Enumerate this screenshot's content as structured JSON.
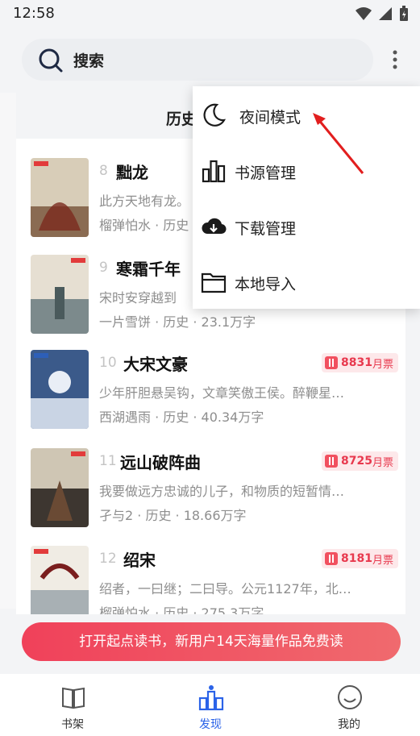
{
  "status": {
    "time": "12:58"
  },
  "search": {
    "label": "搜索"
  },
  "tabs": {
    "history": "历史"
  },
  "books": [
    {
      "rank": "8",
      "title": "黜龙",
      "desc": "此方天地有龙。",
      "meta": "榴弹怕水 · 历史",
      "badge_num": "",
      "badge_unit": ""
    },
    {
      "rank": "9",
      "title": "寒霜千年",
      "desc": "宋时安穿越到",
      "meta": "一片雪饼 · 历史 · 23.1万字",
      "badge_num": "",
      "badge_unit": ""
    },
    {
      "rank": "10",
      "title": "大宋文豪",
      "desc": "少年肝胆悬吴钩，文章笑傲王侯。醉鞭星…",
      "meta": "西湖遇雨 · 历史 · 40.34万字",
      "badge_num": "8831",
      "badge_unit": "月票"
    },
    {
      "rank": "11",
      "title": "远山破阵曲",
      "desc": "我要做远方忠诚的儿子，和物质的短暂情…",
      "meta": "孑与2 · 历史 · 18.66万字",
      "badge_num": "8725",
      "badge_unit": "月票"
    },
    {
      "rank": "12",
      "title": "绍宋",
      "desc": "绍者，一曰继；二曰导。公元1127年，北…",
      "meta": "榴弹怕水 · 历史 · 275.3万字",
      "badge_num": "8181",
      "badge_unit": "月票"
    }
  ],
  "menu": {
    "items": [
      {
        "label": "夜间模式",
        "icon": "moon-icon"
      },
      {
        "label": "书源管理",
        "icon": "bar-chart-icon"
      },
      {
        "label": "下载管理",
        "icon": "cloud-download-icon"
      },
      {
        "label": "本地导入",
        "icon": "folder-icon"
      }
    ]
  },
  "banner": {
    "text": "打开起点读书，新用户14天海量作品免费读"
  },
  "tabbar": {
    "items": [
      {
        "label": "书架",
        "icon": "book-icon"
      },
      {
        "label": "发现",
        "icon": "discover-icon"
      },
      {
        "label": "我的",
        "icon": "smile-icon"
      }
    ]
  },
  "colors": {
    "accent": "#2b63e8",
    "badge": "#e8394e",
    "banner_start": "#f0415a",
    "banner_end": "#f06a6e"
  }
}
